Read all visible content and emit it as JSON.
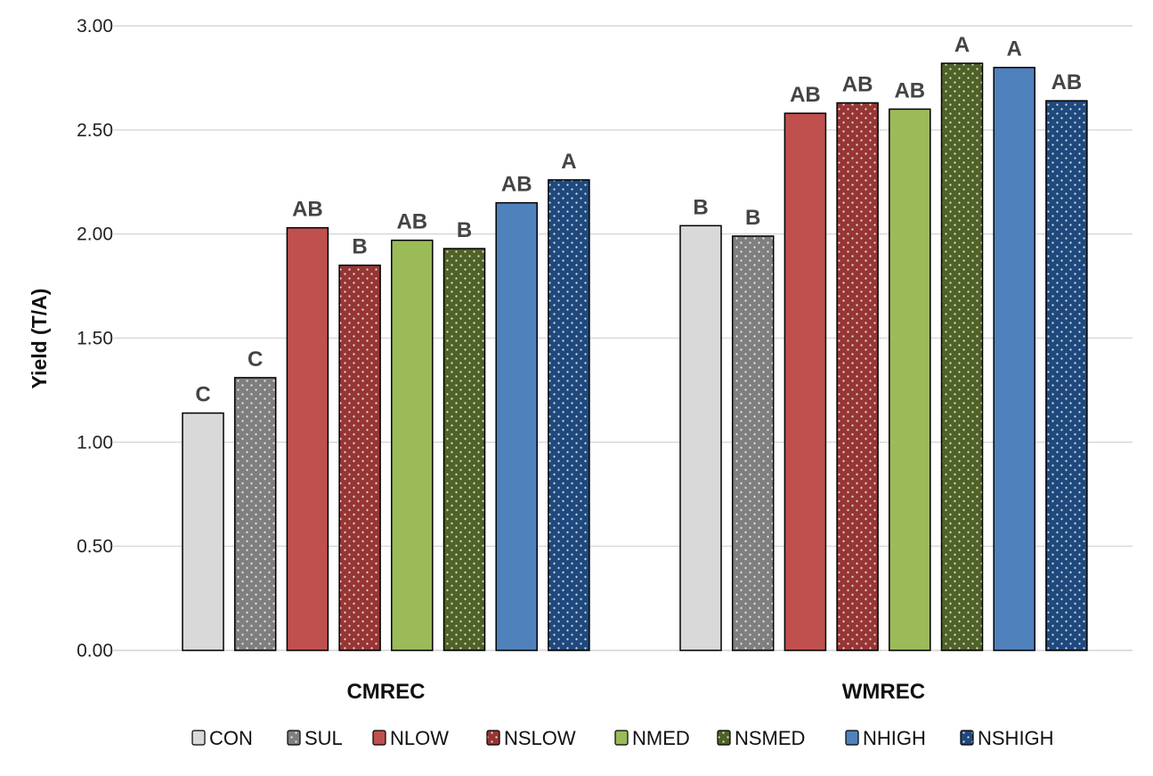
{
  "chart_data": {
    "type": "bar",
    "title": "",
    "xlabel": "",
    "ylabel": "Yield (T/A)",
    "ylim": [
      0,
      3.0
    ],
    "yticks": [
      "0.00",
      "0.50",
      "1.00",
      "1.50",
      "2.00",
      "2.50",
      "3.00"
    ],
    "ytick_values": [
      0,
      0.5,
      1.0,
      1.5,
      2.0,
      2.5,
      3.0
    ],
    "grid": true,
    "legend_position": "bottom",
    "categories": [
      "CMREC",
      "WMREC"
    ],
    "series": [
      {
        "name": "CON",
        "color": "#D9D9D9",
        "pattern": "solid",
        "values": [
          1.14,
          2.04
        ],
        "letters": [
          "C",
          "B"
        ]
      },
      {
        "name": "SUL",
        "color": "#7F7F7F",
        "pattern": "dotted",
        "values": [
          1.31,
          1.99
        ],
        "letters": [
          "C",
          "B"
        ]
      },
      {
        "name": "NLOW",
        "color": "#C0504D",
        "pattern": "solid",
        "values": [
          2.03,
          2.58
        ],
        "letters": [
          "AB",
          "AB"
        ]
      },
      {
        "name": "NSLOW",
        "color": "#963634",
        "pattern": "dotted",
        "values": [
          1.85,
          2.63
        ],
        "letters": [
          "B",
          "AB"
        ]
      },
      {
        "name": "NMED",
        "color": "#9BBB59",
        "pattern": "solid",
        "values": [
          1.97,
          2.6
        ],
        "letters": [
          "AB",
          "AB"
        ]
      },
      {
        "name": "NSMED",
        "color": "#4F6228",
        "pattern": "dotted",
        "values": [
          1.93,
          2.82
        ],
        "letters": [
          "B",
          "A"
        ]
      },
      {
        "name": "NHIGH",
        "color": "#4F81BD",
        "pattern": "solid",
        "values": [
          2.15,
          2.8
        ],
        "letters": [
          "AB",
          "A"
        ]
      },
      {
        "name": "NSHIGH",
        "color": "#1F497D",
        "pattern": "dotted",
        "values": [
          2.26,
          2.64
        ],
        "letters": [
          "A",
          "AB"
        ]
      }
    ]
  }
}
